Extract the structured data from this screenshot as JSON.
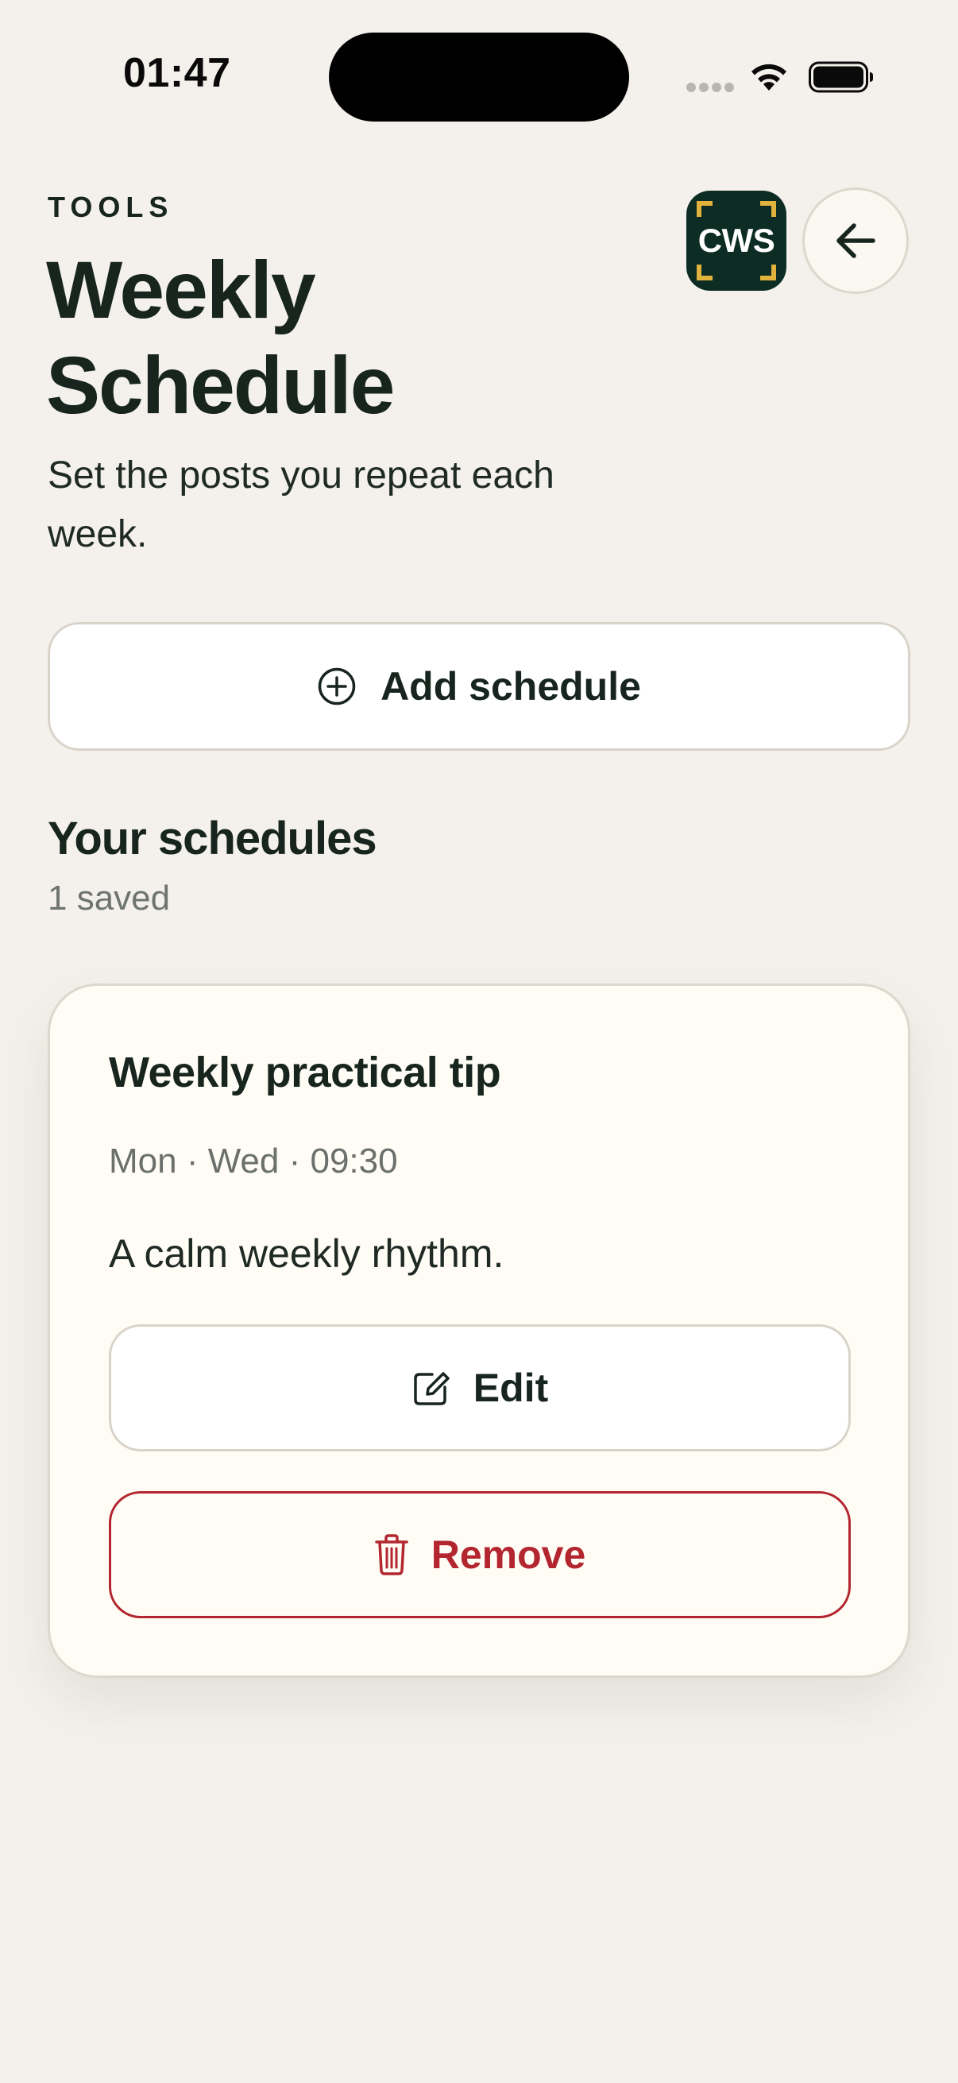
{
  "status_bar": {
    "time": "01:47"
  },
  "header": {
    "eyebrow": "TOOLS",
    "title": "Weekly Schedule",
    "subtitle": "Set the posts you repeat each week.",
    "logo_text": "CWS"
  },
  "actions": {
    "add_label": "Add schedule"
  },
  "schedules_section": {
    "title": "Your schedules",
    "count_label": "1 saved"
  },
  "schedules": [
    {
      "title": "Weekly practical tip",
      "meta": "Mon · Wed · 09:30",
      "description": "A calm weekly rhythm.",
      "edit_label": "Edit",
      "remove_label": "Remove"
    }
  ],
  "icons": {
    "add": "plus-circle-icon",
    "edit": "edit-square-icon",
    "remove": "trash-icon",
    "back": "arrow-left-icon",
    "wifi": "wifi-icon",
    "battery": "battery-icon",
    "signal": "signal-icon"
  },
  "colors": {
    "background": "#f4f1ec",
    "ink": "#17251e",
    "logo_bg": "#0d2c24",
    "logo_accent": "#e2b33c",
    "danger": "#b3262f",
    "muted": "#6e7470"
  }
}
